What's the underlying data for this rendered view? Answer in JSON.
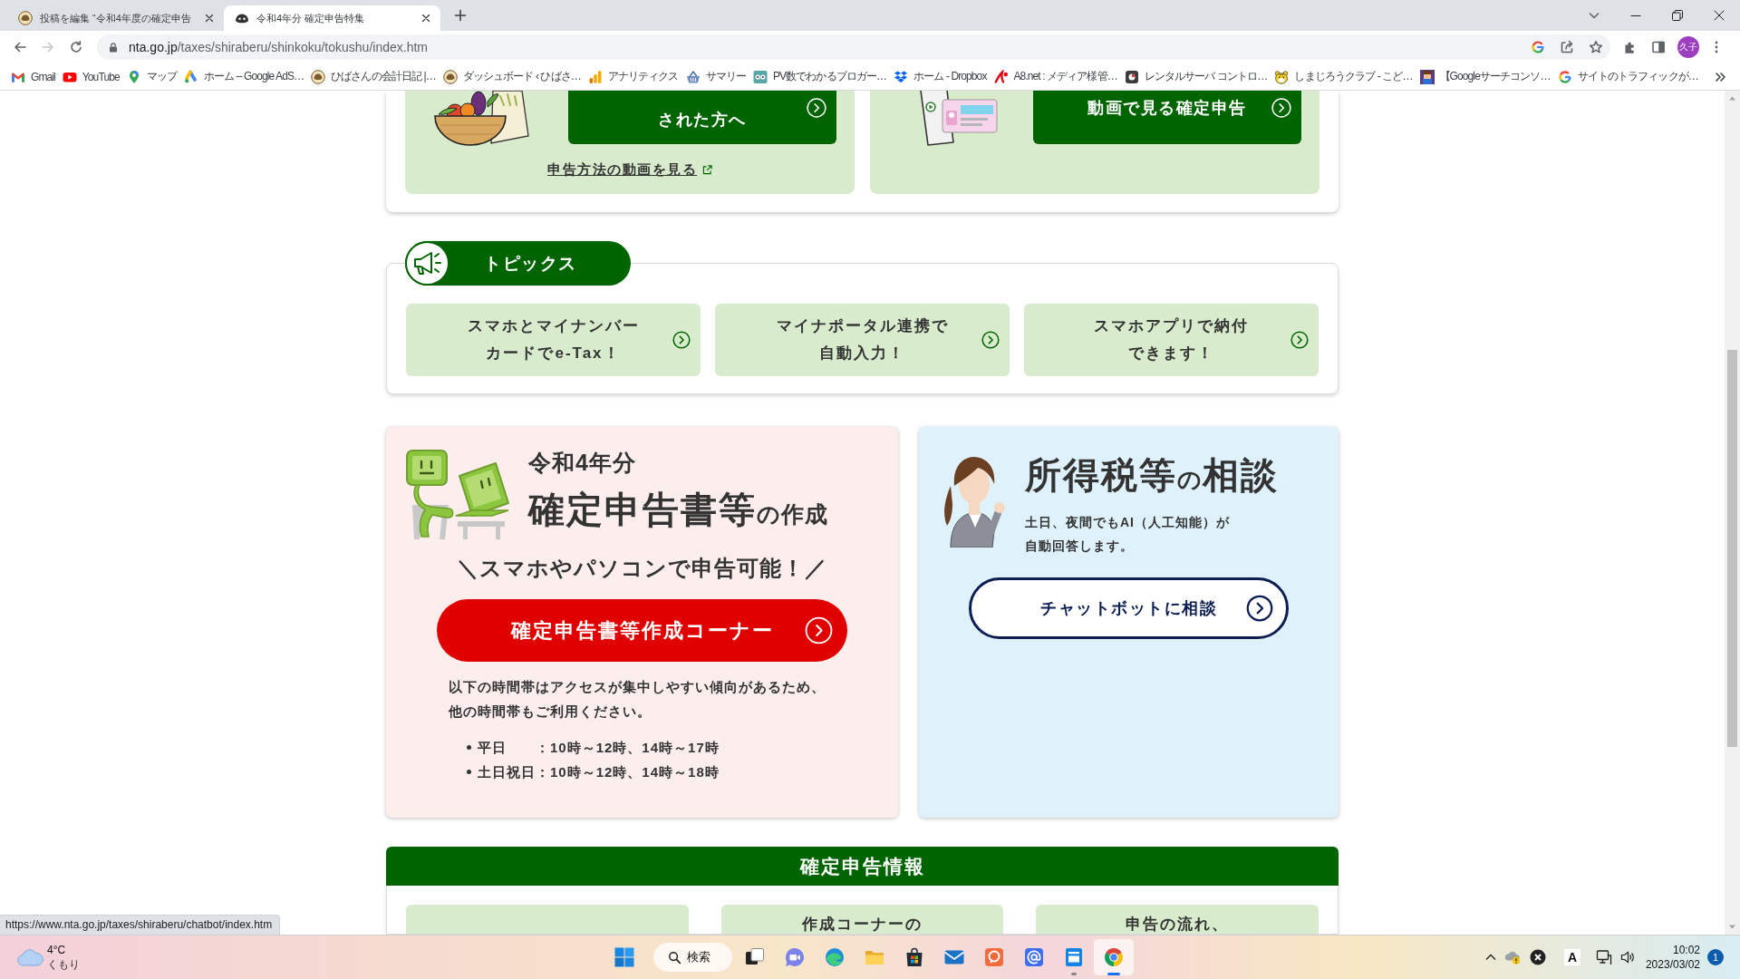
{
  "browser": {
    "tabs": [
      {
        "title": "投稿を編集 “令和4年度の確定申告",
        "selected": false
      },
      {
        "title": "令和4年分 確定申告特集",
        "selected": true
      }
    ],
    "nav": {
      "back_disabled": false,
      "forward_disabled": true
    },
    "address": {
      "host": "nta.go.jp",
      "path": "/taxes/shiraberu/shinkoku/tokushu/index.htm"
    },
    "profile": "久子",
    "bookmarks": [
      "Gmail",
      "YouTube",
      "マップ",
      "ホーム – Google AdS…",
      "ひばさんの会計日記 |…",
      "ダッシュボード ‹ ひばさ…",
      "アナリティクス",
      "サマリー",
      "PV数でわかるブロガー…",
      "ホーム - Dropbox",
      "A8.net : メディア様管…",
      "レンタルサーバ コントロ…",
      "しまじろうクラブ - こど…",
      "【Googleサーチコンソ…",
      "サイトのトラフィックが…"
    ],
    "status_url": "https://www.nta.go.jp/taxes/shiraberu/chatbot/index.htm"
  },
  "page": {
    "top_panels": [
      {
        "button": "された方へ",
        "link": "申告方法の動画を見る"
      },
      {
        "button": "動画で見る確定申告"
      }
    ],
    "topics": {
      "title": "トピックス",
      "items": [
        "スマホとマイナンバーカードでe-Tax！",
        "マイナポータル連携で自動入力！",
        "スマホアプリで納付できます！"
      ]
    },
    "creation": {
      "year": "令和4年分",
      "title_parts": [
        {
          "text": "確定申告書等",
          "kind": "large"
        },
        {
          "text": "の作成",
          "kind": "small"
        }
      ],
      "tagline": "＼スマホやパソコンで申告可能！／",
      "button": "確定申告書等作成コーナー",
      "notice": "以下の時間帯はアクセスが集中しやすい傾向があるため、他の時間帯もご利用ください。",
      "hours": [
        "平日　　：10時～12時、14時～17時",
        "土日祝日：10時～12時、14時～18時"
      ]
    },
    "consultation": {
      "title_parts": [
        {
          "text": "所得税等",
          "kind": "large"
        },
        {
          "text": "の",
          "kind": "small"
        },
        {
          "text": "相談",
          "kind": "large"
        }
      ],
      "description": "土日、夜間でもAI（人工知能）が自動回答します。",
      "button": "チャットボットに相談"
    },
    "info": {
      "title": "確定申告情報",
      "tiles": [
        {
          "kind": "blank"
        },
        {
          "kind": "text",
          "label": "作成コーナーの"
        },
        {
          "kind": "text",
          "label": "申告の流れ、"
        }
      ]
    }
  },
  "taskbar": {
    "weather": {
      "temperature": "4°C",
      "condition": "くもり"
    },
    "search": "検索",
    "apps": [
      {
        "running": false,
        "selected": false
      },
      {
        "running": false,
        "selected": false
      },
      {
        "running": false,
        "selected": false
      },
      {
        "running": false,
        "selected": false
      },
      {
        "running": false,
        "selected": false
      },
      {
        "running": false,
        "selected": false
      },
      {
        "running": false,
        "selected": false
      },
      {
        "running": false,
        "selected": false
      },
      {
        "running": true,
        "selected": false
      },
      {
        "running": true,
        "selected": true
      }
    ],
    "ime": "A",
    "time": "10:02",
    "date": "2023/03/02",
    "notifications": "1"
  }
}
